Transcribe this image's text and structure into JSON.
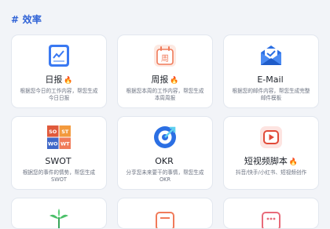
{
  "section": {
    "title": "# 效率"
  },
  "cards": [
    {
      "title": "日报",
      "fire": "🔥",
      "desc": "根据您今日的工作内容，帮您生成今日日报",
      "icon": "daily-report-icon"
    },
    {
      "title": "周报",
      "fire": "🔥",
      "desc": "根据您本周的工作内容，帮您生成本周周报",
      "icon": "weekly-report-icon"
    },
    {
      "title": "E-Mail",
      "fire": "",
      "desc": "根据您的邮件内容，帮您生成完整邮件模板",
      "icon": "mail-icon"
    },
    {
      "title": "SWOT",
      "fire": "",
      "desc": "根据您的事件的情势，帮您生成 SWOT",
      "icon": "swot-icon"
    },
    {
      "title": "OKR",
      "fire": "",
      "desc": "分享您未来要干的事情，帮您生成 OKR",
      "icon": "okr-icon"
    },
    {
      "title": "短视频脚本",
      "fire": "🔥",
      "desc": "抖音/快手/小红书、短视频创作",
      "icon": "video-script-icon"
    }
  ],
  "colors": {
    "accent": "#2f62d6",
    "page_bg": "#f2f4f8",
    "card_bg": "#ffffff"
  }
}
